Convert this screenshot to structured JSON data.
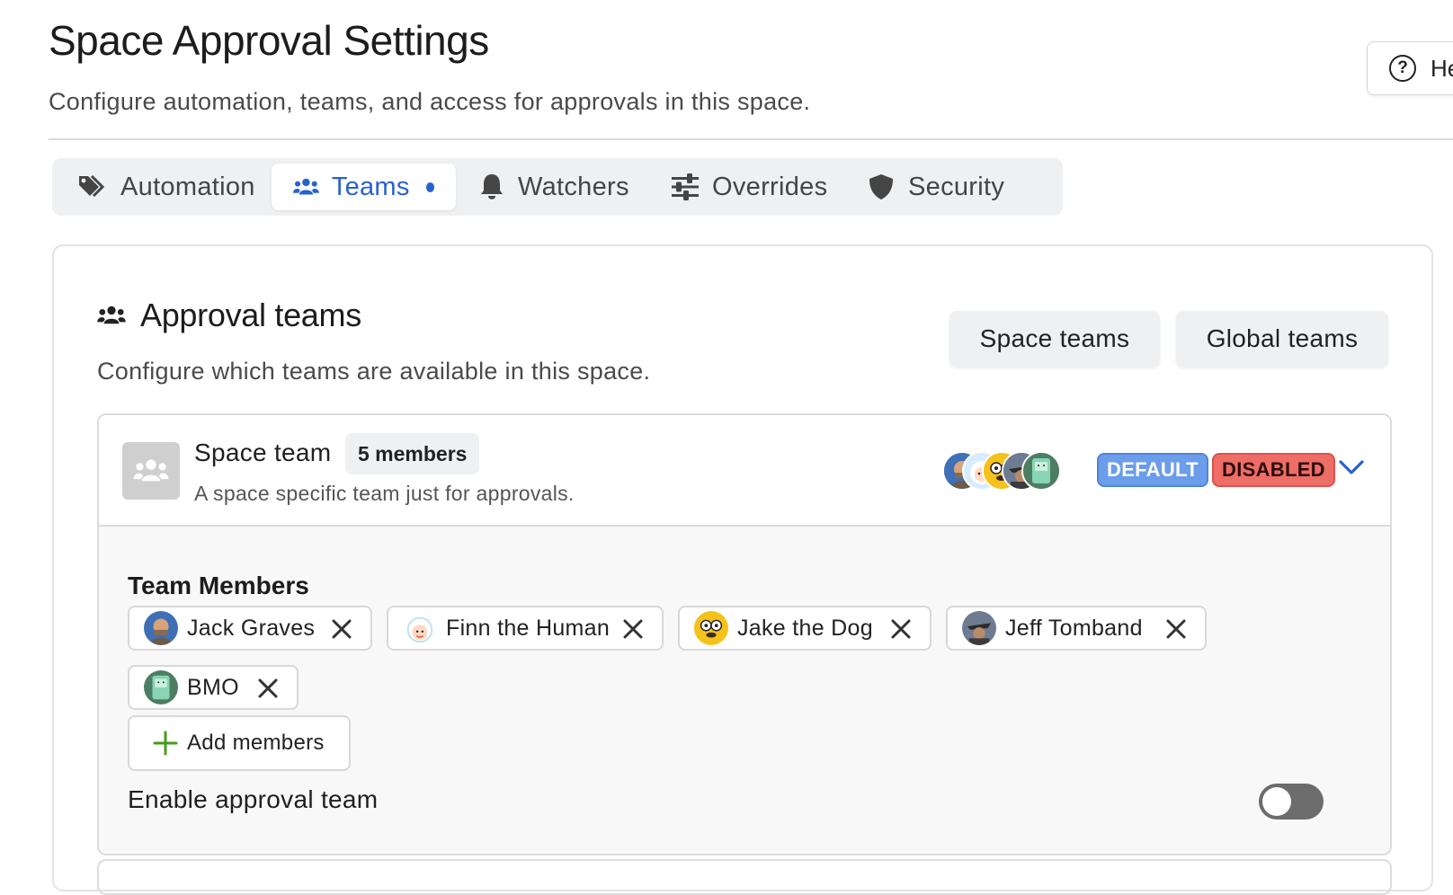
{
  "page": {
    "title": "Space Approval Settings",
    "subtitle": "Configure automation, teams, and access for approvals in this space.",
    "help_label": "Help"
  },
  "tabs": [
    {
      "label": "Automation",
      "icon": "tags-icon"
    },
    {
      "label": "Teams",
      "icon": "users-icon",
      "active": true,
      "indicator": true
    },
    {
      "label": "Watchers",
      "icon": "bell-icon"
    },
    {
      "label": "Overrides",
      "icon": "sliders-icon"
    },
    {
      "label": "Security",
      "icon": "shield-icon"
    }
  ],
  "section": {
    "title": "Approval teams",
    "description": "Configure which teams are available in this space.",
    "space_teams_label": "Space teams",
    "global_teams_label": "Global teams"
  },
  "team": {
    "name": "Space team",
    "members_count_label": "5 members",
    "description": "A space specific team just for approvals.",
    "default_tag": "DEFAULT",
    "disabled_tag": "DISABLED",
    "members_heading": "Team Members",
    "members": [
      {
        "name": "Jack Graves"
      },
      {
        "name": "Finn the Human"
      },
      {
        "name": "Jake the Dog"
      },
      {
        "name": "Jeff Tomband"
      },
      {
        "name": "BMO"
      }
    ],
    "add_members_label": "Add members",
    "enable_label": "Enable approval team",
    "enabled": false
  },
  "colors": {
    "accent": "#2762cf",
    "default_tag": "#6b9dea",
    "disabled_tag": "#ee6d66",
    "add_icon": "#4a9a1e"
  }
}
